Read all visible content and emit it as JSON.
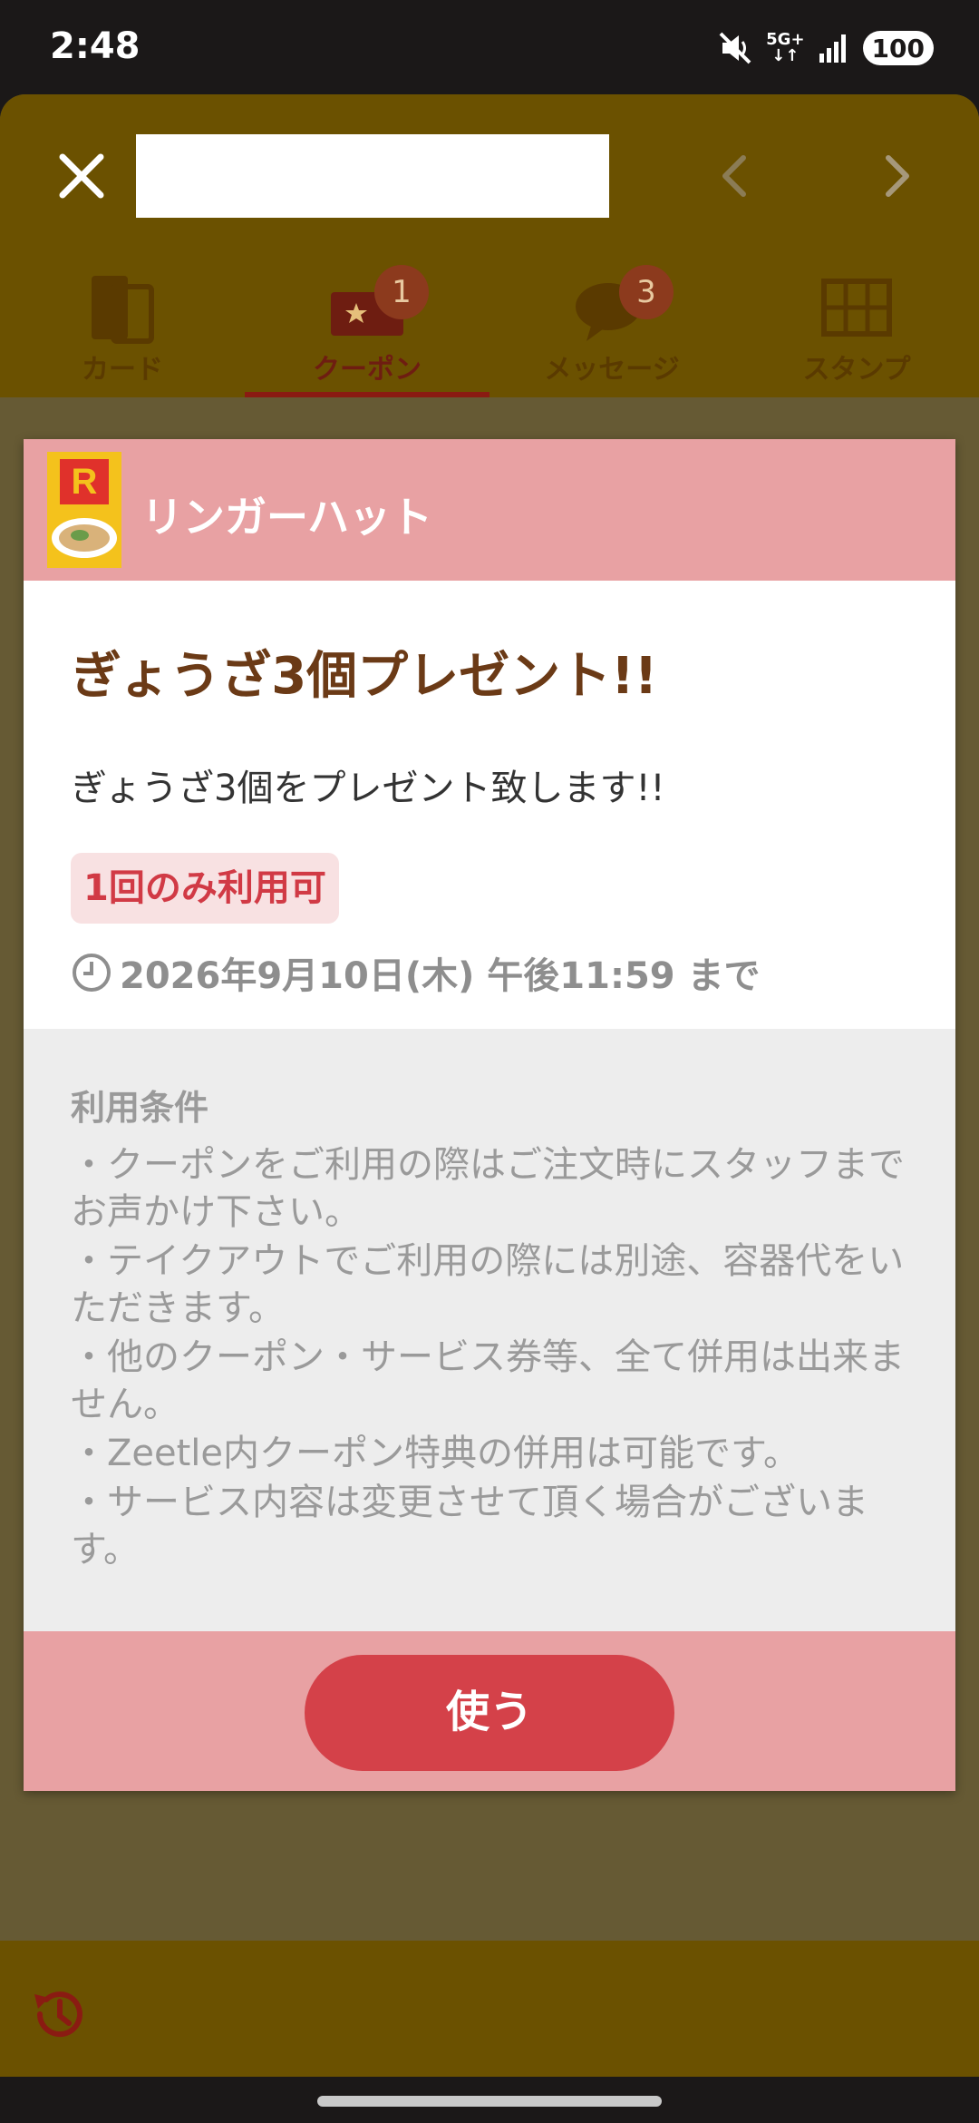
{
  "status_bar": {
    "time": "2:48",
    "network": "5G+",
    "battery": "100"
  },
  "header": {
    "title": "",
    "close_icon": "close-icon",
    "prev_icon": "chevron-left-icon",
    "next_icon": "chevron-right-icon"
  },
  "tabs": [
    {
      "label": "カード",
      "icon": "card-icon",
      "badge": null,
      "active": false
    },
    {
      "label": "クーポン",
      "icon": "coupon-icon",
      "badge": "1",
      "active": true
    },
    {
      "label": "メッセージ",
      "icon": "message-icon",
      "badge": "3",
      "active": false
    },
    {
      "label": "スタンプ",
      "icon": "stamp-icon",
      "badge": null,
      "active": false
    }
  ],
  "coupon": {
    "brand": "リンガーハット",
    "logo_text": "RingerHut",
    "title": "ぎょうざ3個プレゼント!!",
    "description": "ぎょうざ3個をプレゼント致します!!",
    "usage_limit": "1回のみ利用可",
    "expiry": "2026年9月10日(木) 午後11:59 まで",
    "terms_title": "利用条件",
    "terms": [
      "・クーポンをご利用の際はご注文時にスタッフまでお声かけ下さい。",
      "・テイクアウトでご利用の際には別途、容器代をいただきます。",
      "・他のクーポン・サービス券等、全て併用は出来ません。",
      "・Zeetle内クーポン特典の併用は可能です。",
      "・サービス内容は変更させて頂く場合がございます。"
    ],
    "use_button": "使う"
  },
  "colors": {
    "header_bg": "#6b5100",
    "card_accent": "#e8a1a3",
    "button": "#d44149",
    "title": "#6b3a16"
  }
}
